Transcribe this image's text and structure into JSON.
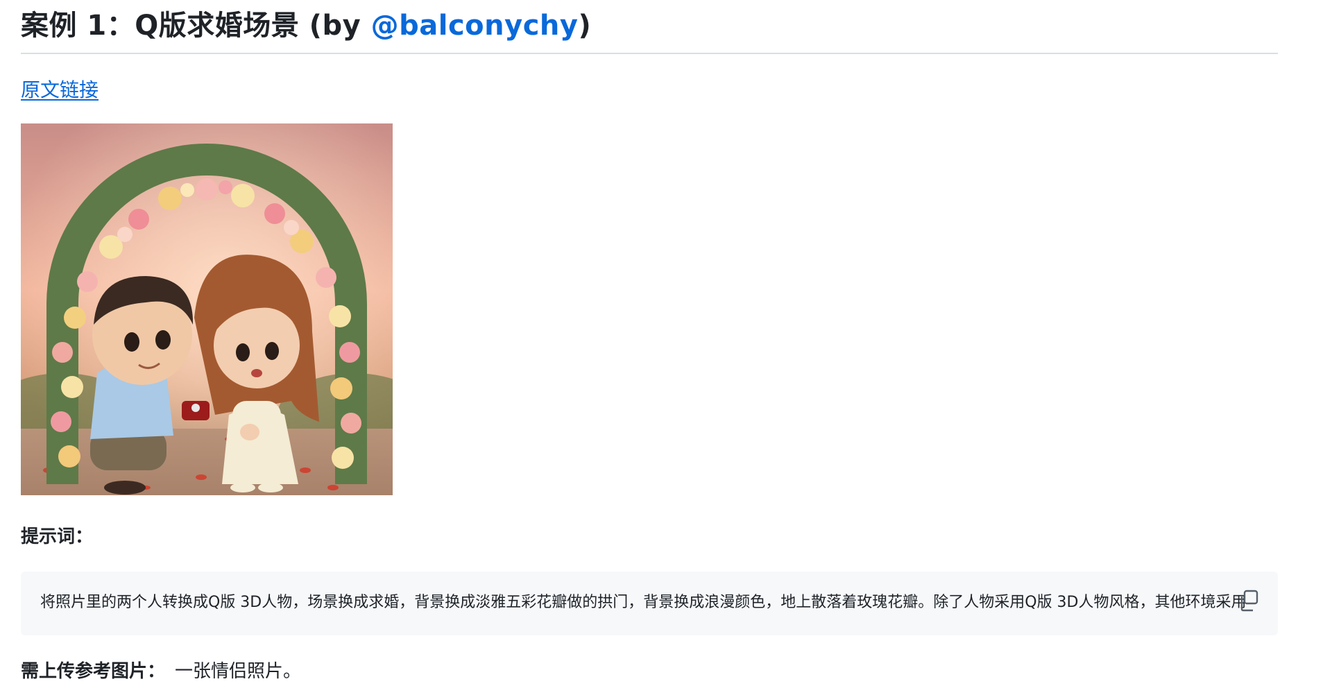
{
  "heading": {
    "prefix": "案例 1：Q版求婚场景 (by ",
    "author": "@balconychy",
    "suffix": ")"
  },
  "source_link": "原文链接",
  "illustration_icon": "proposal-illustration",
  "prompt": {
    "label": "提示词：",
    "text": "将照片里的两个人转换成Q版  3D人物，场景换成求婚，背景换成淡雅五彩花瓣做的拱门，背景换成浪漫颜色，地上散落着玫瑰花瓣。除了人物采用Q版  3D人物风格，其他环境采用真实写实风格。",
    "copy_icon": "copy-icon"
  },
  "upload": {
    "label": "需上传参考图片：",
    "value": "一张情侣照片。"
  },
  "colors": {
    "link": "#0969da",
    "code_bg": "#f6f8fa",
    "divider": "#d8dee4"
  }
}
